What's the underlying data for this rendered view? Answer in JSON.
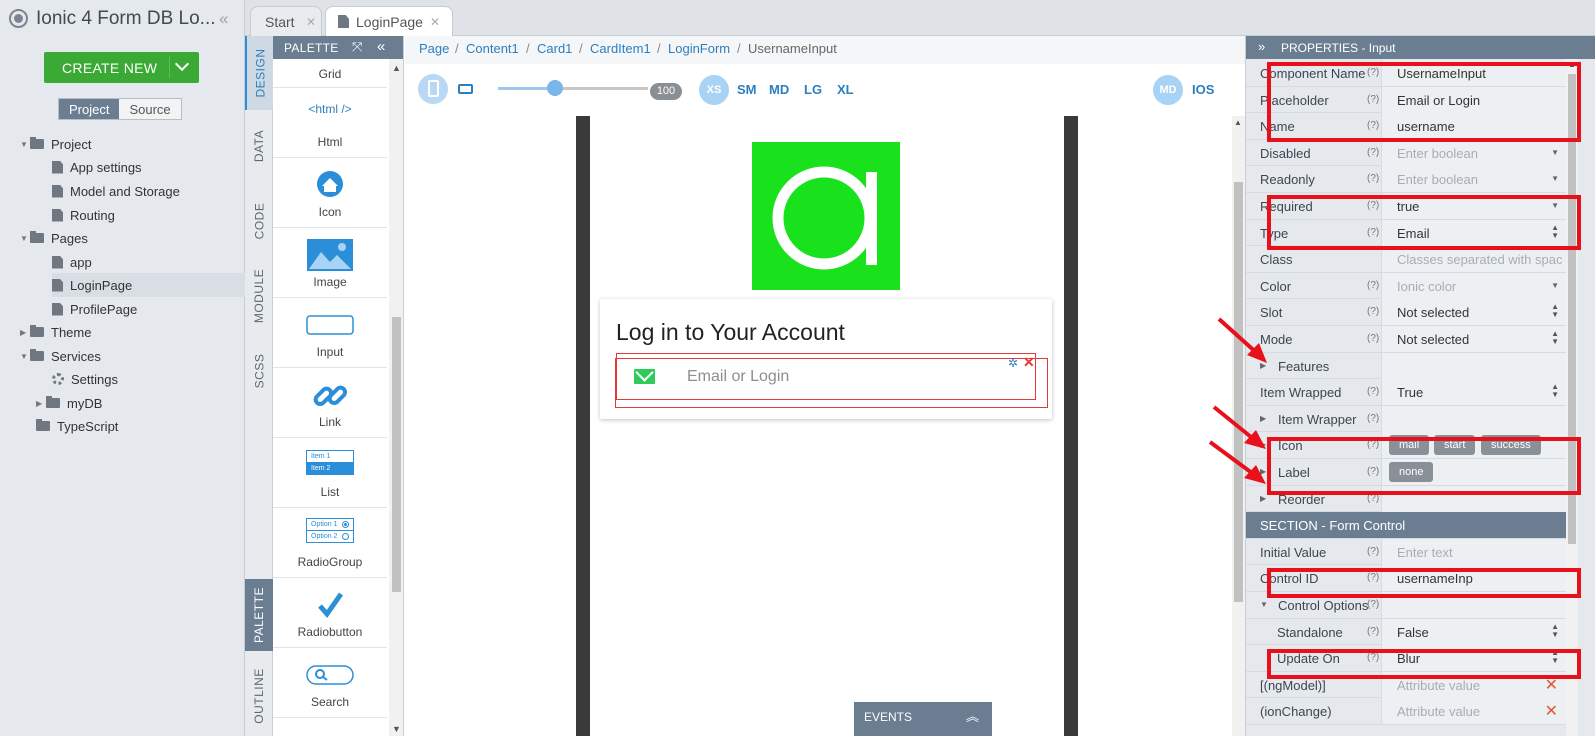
{
  "app": {
    "title": "Ionic 4 Form DB Lo..."
  },
  "left_panel": {
    "create_new_label": "CREATE NEW",
    "tabs": [
      {
        "label": "Project"
      },
      {
        "label": "Source"
      }
    ],
    "tree": [
      {
        "label": "Project"
      },
      {
        "label": "App settings"
      },
      {
        "label": "Model and Storage"
      },
      {
        "label": "Routing"
      },
      {
        "label": "Pages"
      },
      {
        "label": "app"
      },
      {
        "label": "LoginPage"
      },
      {
        "label": "ProfilePage"
      },
      {
        "label": "Theme"
      },
      {
        "label": "Services"
      },
      {
        "label": "Settings"
      },
      {
        "label": "myDB"
      },
      {
        "label": "TypeScript"
      }
    ]
  },
  "side_tabs": {
    "design": "DESIGN",
    "data": "DATA",
    "code": "CODE",
    "module": "MODULE",
    "scss": "SCSS",
    "palette": "PALETTE",
    "outline": "OUTLINE"
  },
  "doc_tabs": [
    {
      "label": "Start"
    },
    {
      "label": "LoginPage"
    }
  ],
  "palette": {
    "title": "PALETTE",
    "items": [
      {
        "label": "Grid"
      },
      {
        "label": "Html",
        "glyph": "<html />"
      },
      {
        "label": "Icon"
      },
      {
        "label": "Image"
      },
      {
        "label": "Input"
      },
      {
        "label": "Link"
      },
      {
        "label": "List",
        "glyph1": "Item 1",
        "glyph2": "Item 2"
      },
      {
        "label": "RadioGroup",
        "glyph1": "Option 1",
        "glyph2": "Option 2"
      },
      {
        "label": "Radiobutton"
      },
      {
        "label": "Search"
      }
    ]
  },
  "breadcrumb": [
    "Page",
    "Content1",
    "Card1",
    "CardItem1",
    "LoginForm",
    "UsernameInput"
  ],
  "toolbar": {
    "zoom_fraction": 0.38,
    "zoom_value": "100",
    "breakpoints": [
      "XS",
      "SM",
      "MD",
      "LG",
      "XL"
    ],
    "mode_md": "MD",
    "mode_ios": "IOS"
  },
  "canvas": {
    "card_title": "Log in to Your Account",
    "input_placeholder": "Email or Login",
    "events_label": "EVENTS"
  },
  "properties": {
    "title": "PROPERTIES - Input",
    "help": "(?)",
    "rows": [
      {
        "key": "Component Name",
        "value": "UsernameInput"
      },
      {
        "key": "Placeholder",
        "value": "Email or Login"
      },
      {
        "key": "Name",
        "value": "username"
      },
      {
        "key": "Disabled",
        "value": "Enter boolean"
      },
      {
        "key": "Readonly",
        "value": "Enter boolean"
      },
      {
        "key": "Required",
        "value": "true"
      },
      {
        "key": "Type",
        "value": "Email"
      },
      {
        "key": "Class",
        "value": "Classes separated with spac"
      },
      {
        "key": "Color",
        "value": "Ionic color"
      },
      {
        "key": "Slot",
        "value": "Not selected"
      },
      {
        "key": "Mode",
        "value": "Not selected"
      },
      {
        "key": "Features",
        "value": ""
      },
      {
        "key": "Item Wrapped",
        "value": "True"
      },
      {
        "key": "Item Wrapper",
        "value": ""
      },
      {
        "key": "Icon",
        "chips": [
          "mail",
          "start",
          "success"
        ]
      },
      {
        "key": "Label",
        "chips": [
          "none"
        ]
      },
      {
        "key": "Reorder",
        "value": ""
      },
      {
        "key": "SECTION - Form Control"
      },
      {
        "key": "Initial Value",
        "value": "Enter text"
      },
      {
        "key": "Control ID",
        "value": "usernameInp"
      },
      {
        "key": "Control Options",
        "value": ""
      },
      {
        "key": "Standalone",
        "value": "False"
      },
      {
        "key": "Update On",
        "value": "Blur"
      },
      {
        "key": "[(ngModel)]",
        "value": "Attribute value"
      },
      {
        "key": "(ionChange)",
        "value": "Attribute value"
      }
    ]
  },
  "colors": {
    "accent": "#2a7fc1",
    "create_button": "#3aaa35",
    "highlight": "#e8111b",
    "logo_green": "#19e11b"
  },
  "icons": [
    "app-logo-icon",
    "chevron-down-icon",
    "folder-icon",
    "file-icon",
    "gear-icon",
    "mail-icon",
    "settings-icon",
    "close-icon",
    "phone-icon",
    "tablet-icon"
  ]
}
